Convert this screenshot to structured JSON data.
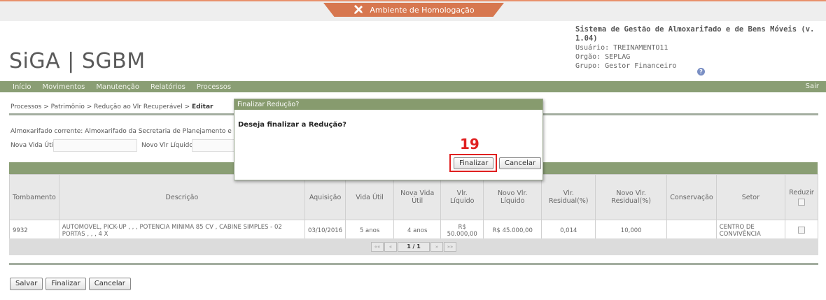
{
  "environment": {
    "label": "Ambiente de Homologação",
    "icon": "tools-icon"
  },
  "header": {
    "logo": "SiGA | SGBM",
    "system_title": "Sistema de Gestão de Almoxarifado e de Bens Móveis (v. 1.04)",
    "user": "Usuário: TREINAMENTO11",
    "org": "Orgão: SEPLAG",
    "group": "Grupo: Gestor Financeiro",
    "help_icon": "?"
  },
  "nav": {
    "items": [
      "Início",
      "Movimentos",
      "Manutenção",
      "Relatórios",
      "Processos"
    ],
    "exit": "Sair"
  },
  "breadcrumb": {
    "path": "Processos  > Patrimônio  > Redução ao Vlr Recuperável  > ",
    "current": "Editar"
  },
  "form": {
    "almox": "Almoxarifado corrente: Almoxarifado da Secretaria de Planejamento e Gestão de",
    "nova_vida_label": "Nova Vida Útil:",
    "novo_vlr_label": "Novo Vlr Líquido:",
    "nova_vida_value": "",
    "novo_vlr_value": ""
  },
  "table": {
    "headers": [
      "Tombamento",
      "Descrição",
      "Aquisição",
      "Vida Útil",
      "Nova Vida Útil",
      "Vlr. Líquido",
      "Novo Vlr. Líquido",
      "Vlr. Residual(%)",
      "Novo Vlr. Residual(%)",
      "Conservação",
      "Setor",
      "Reduzir"
    ],
    "rows": [
      {
        "tombamento": "9932",
        "descricao": "AUTOMOVEL, PICK-UP , , , POTENCIA MINIMA 85 CV , CABINE SIMPLES - 02 PORTAS , , , 4 X",
        "aquisicao": "03/10/2016",
        "vida_util": "5 anos",
        "nova_vida_util": "4 anos",
        "vlr_liquido": "R$ 50.000,00",
        "novo_vlr_liquido": "R$ 45.000,00",
        "vlr_residual": "0,014",
        "novo_vlr_residual": "10,000",
        "conservacao": "",
        "setor": "CENTRO DE CONVIVÊNCIA"
      }
    ],
    "pager": {
      "first": "««",
      "prev": "«",
      "page": "1 / 1",
      "next": "»",
      "last": "»»"
    }
  },
  "buttons": {
    "save": "Salvar",
    "finish": "Finalizar",
    "cancel": "Cancelar"
  },
  "modal": {
    "title": "Finalizar Redução?",
    "message": "Deseja finalizar a Redução?",
    "confirm": "Finalizar",
    "cancel": "Cancelar",
    "annotation": "19"
  },
  "colors": {
    "nav": "#8a9e74",
    "accent": "#d7774f",
    "annotation": "#e02020"
  }
}
